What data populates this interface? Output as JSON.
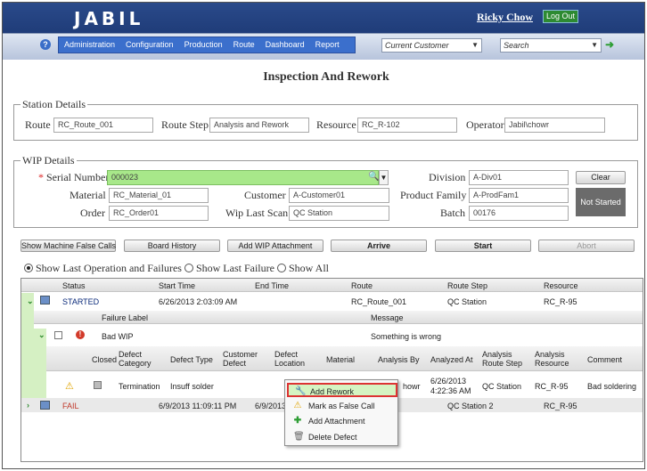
{
  "header": {
    "logo": "JABIL",
    "user_name": "Ricky Chow",
    "logout_label": "Log Out"
  },
  "nav": {
    "menu": [
      "Administration",
      "Configuration",
      "Production",
      "Route",
      "Dashboard",
      "Report"
    ],
    "customer_placeholder": "Current Customer",
    "search_placeholder": "Search"
  },
  "page_title": "Inspection And Rework",
  "station": {
    "legend": "Station Details",
    "route_label": "Route",
    "route_value": "RC_Route_001",
    "route_step_label": "Route Step",
    "route_step_value": "Analysis and Rework",
    "resource_label": "Resource",
    "resource_value": "RC_R-102",
    "operator_label": "Operator",
    "operator_value": "Jabil\\chowr"
  },
  "wip": {
    "legend": "WIP Details",
    "required_mark": "*",
    "serial_label": "Serial Number",
    "serial_value": "000023",
    "material_label": "Material",
    "material_value": "RC_Material_01",
    "order_label": "Order",
    "order_value": "RC_Order01",
    "customer_label": "Customer",
    "customer_value": "A-Customer01",
    "wip_last_scan_label": "Wip Last Scan",
    "wip_last_scan_value": "QC Station",
    "division_label": "Division",
    "division_value": "A-Div01",
    "product_family_label": "Product Family",
    "product_family_value": "A-ProdFam1",
    "batch_label": "Batch",
    "batch_value": "00176",
    "clear_label": "Clear",
    "status_label": "Not Started"
  },
  "actions": {
    "show_false_calls": "Show Machine False Calls",
    "board_history": "Board History",
    "add_wip_attachment": "Add WIP Attachment",
    "arrive": "Arrive",
    "start": "Start",
    "abort": "Abort"
  },
  "filters": {
    "option1": "Show Last Operation and Failures",
    "option2": "Show Last Failure",
    "option3": "Show All"
  },
  "grid": {
    "columns": [
      "Status",
      "Start Time",
      "End Time",
      "Route",
      "Route Step",
      "Resource"
    ],
    "rows": [
      {
        "status": "STARTED",
        "start": "6/26/2013 2:03:09 AM",
        "end": "",
        "route": "RC_Route_001",
        "step": "QC Station",
        "resource": "RC_R-95"
      },
      {
        "status": "FAIL",
        "start": "6/9/2013 11:09:11 PM",
        "end": "6/9/2013",
        "route": "",
        "step": "QC Station 2",
        "resource": "RC_R-95"
      }
    ],
    "failure_columns": [
      "Failure Label",
      "Message"
    ],
    "failure": {
      "label": "Bad WIP",
      "message": "Something is wrong"
    },
    "defect_columns": [
      "Closed",
      "Defect Category",
      "Defect Type",
      "Customer Defect",
      "Defect Location",
      "Material",
      "Analysis By",
      "Analyzed At",
      "Analysis Route Step",
      "Analysis Resource",
      "Comment"
    ],
    "defect": {
      "category": "Termination",
      "type": "Insuff solder",
      "analysis_by": "howr",
      "analyzed_at_date": "6/26/2013",
      "analyzed_at_time": "4:22:36 AM",
      "route_step": "QC Station",
      "resource": "RC_R-95",
      "comment": "Bad soldering"
    }
  },
  "context_menu": {
    "items": [
      "Add Rework",
      "Mark as False Call",
      "Add Attachment",
      "Delete Defect"
    ]
  }
}
